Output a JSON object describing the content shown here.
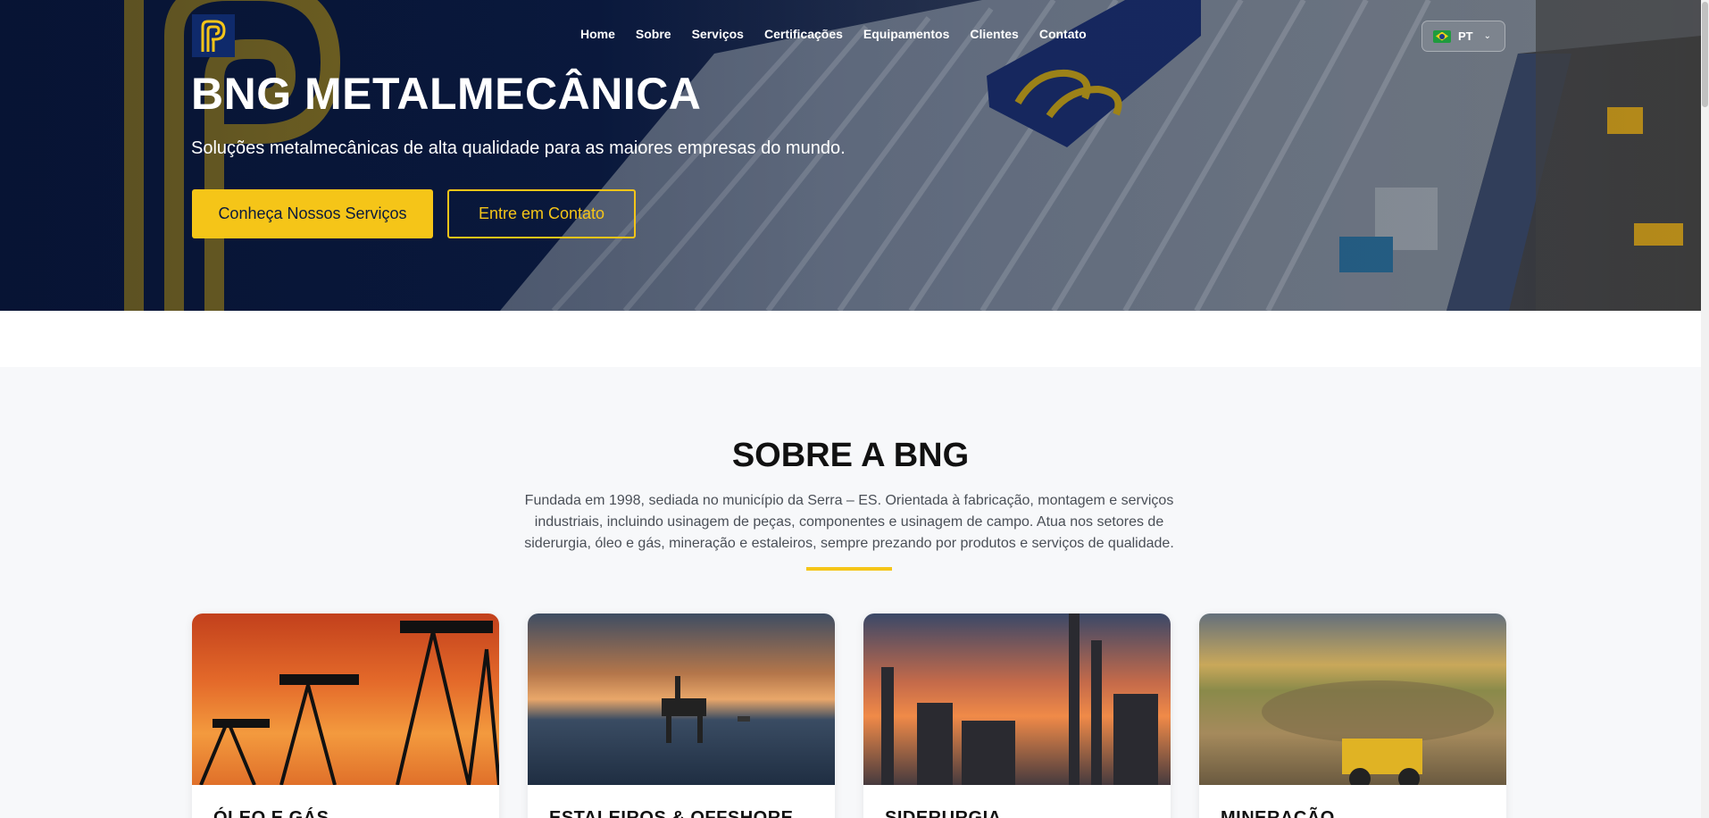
{
  "brand": {
    "name": "BNG"
  },
  "nav": {
    "items": [
      "Home",
      "Sobre",
      "Serviços",
      "Certificações",
      "Equipamentos",
      "Clientes",
      "Contato"
    ]
  },
  "language": {
    "code": "PT",
    "flag_icon": "brazil-flag-icon"
  },
  "hero": {
    "title": "BNG METALMECÂNICA",
    "subtitle": "Soluções metalmecânicas de alta qualidade para as maiores empresas do mundo.",
    "primary_button": "Conheça Nossos Serviços",
    "secondary_button": "Entre em Contato"
  },
  "about": {
    "title": "SOBRE A BNG",
    "text": "Fundada em 1998, sediada no município da Serra – ES. Orientada à fabricação, montagem e serviços industriais, incluindo usinagem de peças, componentes e usinagem de campo. Atua nos setores de siderurgia, óleo e gás, mineração e estaleiros, sempre prezando por produtos e serviços de qualidade."
  },
  "sectors": [
    {
      "title": "ÓLEO E GÁS"
    },
    {
      "title": "ESTALEIROS & OFFSHORE"
    },
    {
      "title": "SIDERURGIA"
    },
    {
      "title": "MINERAÇÃO"
    }
  ],
  "colors": {
    "primary_navy": "#0a1a3d",
    "accent_yellow": "#f5c518"
  }
}
